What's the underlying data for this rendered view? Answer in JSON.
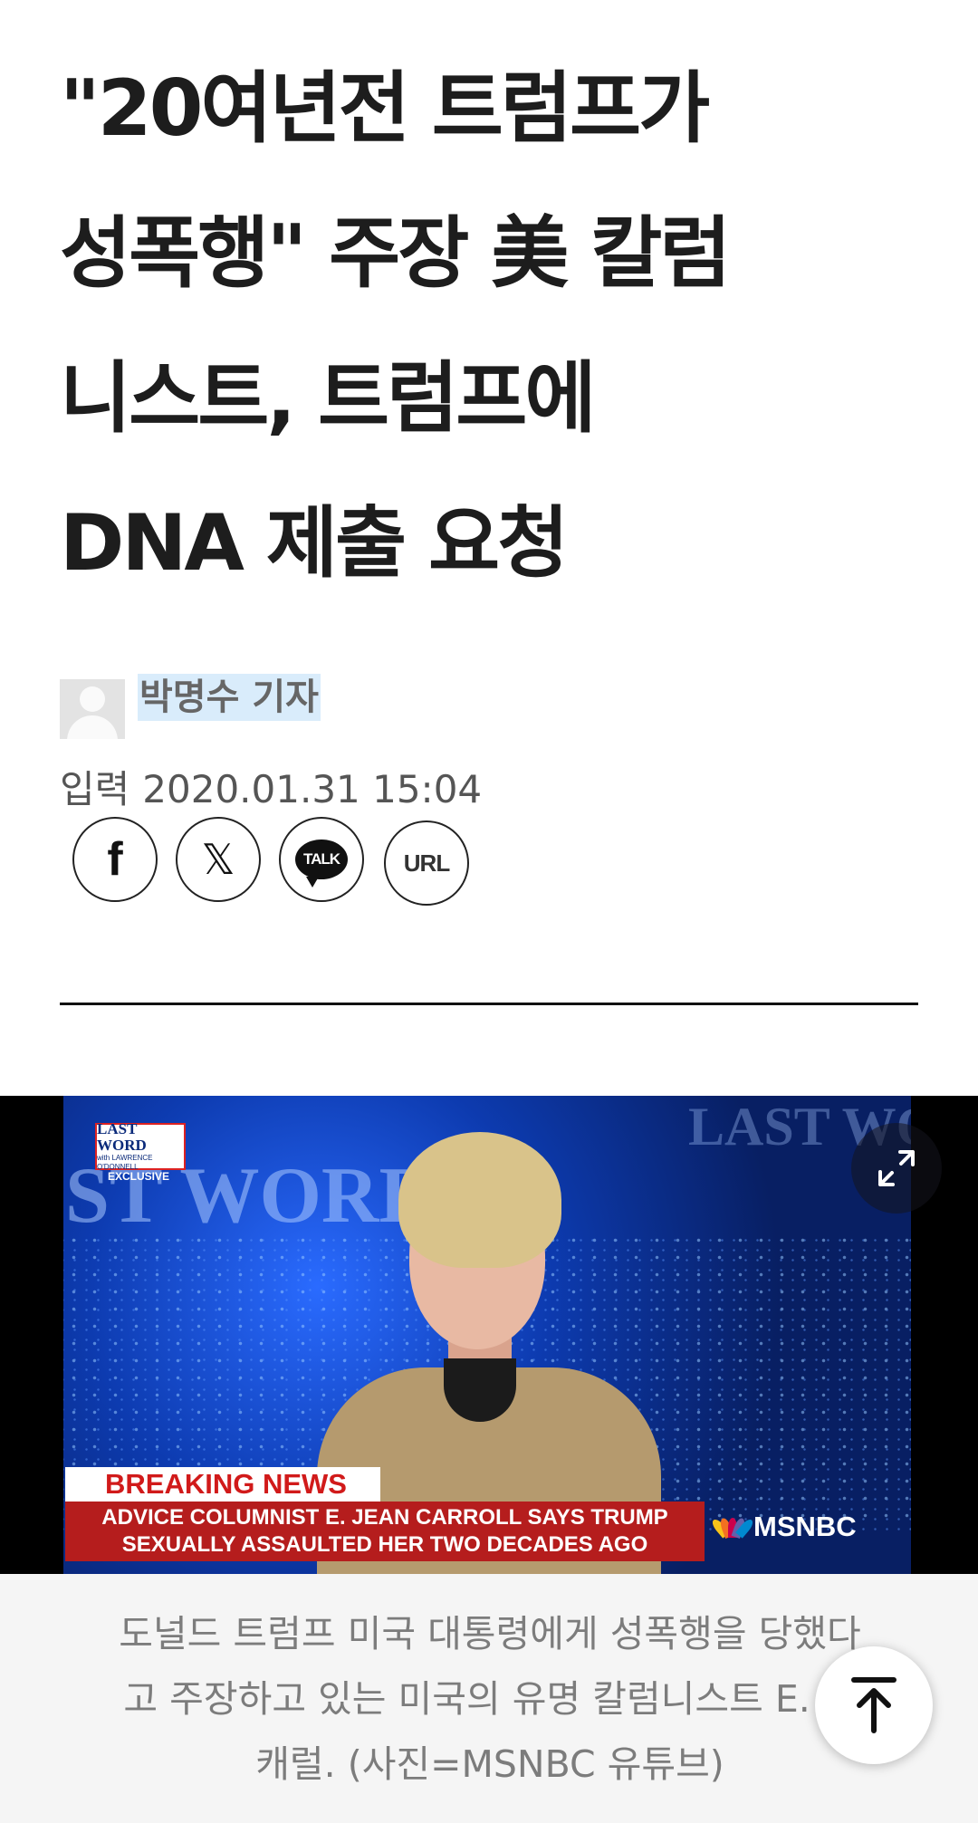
{
  "article": {
    "headline_lines": [
      "\"20여년전 트럼프가",
      "성폭행\" 주장 美 칼럼",
      "니스트, 트럼프에",
      "DNA 제출 요청"
    ],
    "author": "박명수 기자",
    "published_label": "입력",
    "published_at": "2020.01.31 15:04"
  },
  "share": {
    "facebook_label": "f",
    "x_label": "𝕏",
    "kakaotalk_label": "TALK",
    "url_label": "URL"
  },
  "photo": {
    "program_logo": "LAST WORD",
    "program_logo_sub": "with LAWRENCE O'DONNELL",
    "program_badge": "EXCLUSIVE",
    "wall_text": "ST WORD",
    "wall_text_2": "LAST WORL",
    "breaking_label": "BREAKING NEWS",
    "ticker_line1": "ADVICE COLUMNIST E. JEAN CARROLL SAYS TRUMP",
    "ticker_line2": "SEXUALLY ASSAULTED HER TWO DECADES AGO",
    "network": "MSNBC"
  },
  "caption": {
    "lines": [
      "도널드 트럼프 미국 대통령에게 성폭행을 당했다",
      "고 주장하고 있는 미국의 유명 칼럼니스트 E. 진",
      "캐럴. (사진=MSNBC 유튜브)"
    ]
  },
  "icons": {
    "expand": "expand-icon",
    "scroll_top": "arrow-up-to-top-icon"
  }
}
